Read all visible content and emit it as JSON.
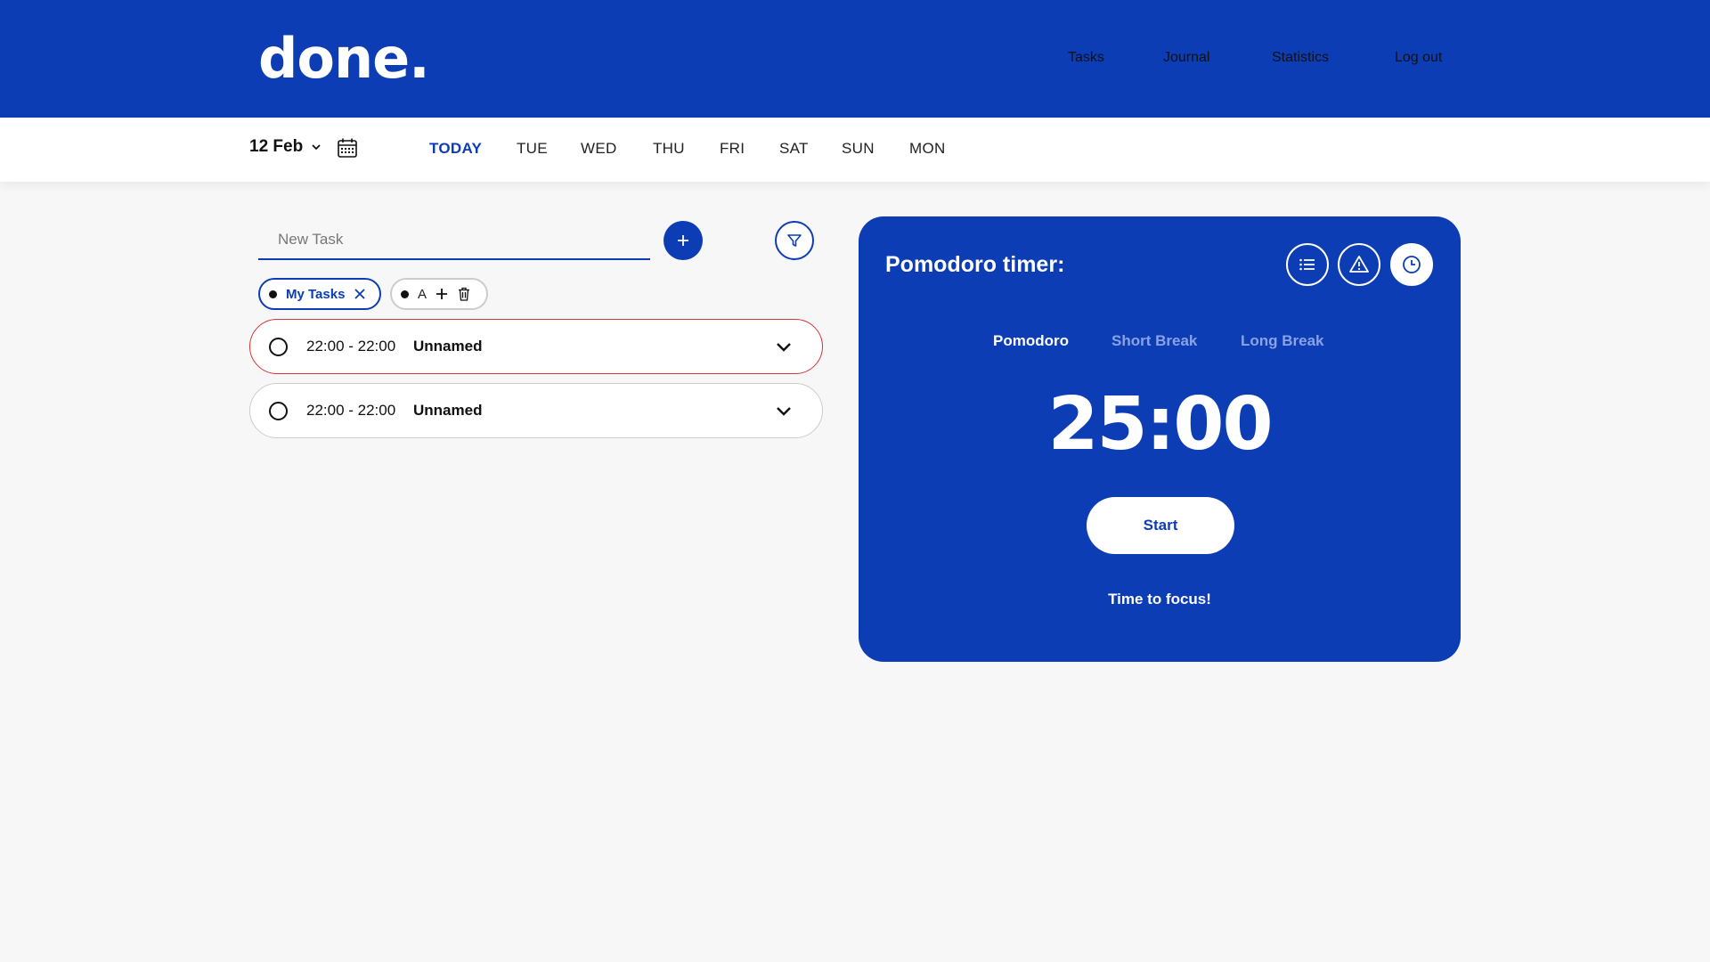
{
  "header": {
    "logo": "done.",
    "nav": [
      "Tasks",
      "Journal",
      "Statistics",
      "Log out"
    ]
  },
  "daybar": {
    "date": "12 Feb",
    "days": [
      "TODAY",
      "TUE",
      "WED",
      "THU",
      "FRI",
      "SAT",
      "SUN",
      "MON"
    ],
    "active_day": "TODAY"
  },
  "tasks_panel": {
    "new_task_placeholder": "New Task",
    "chips": [
      {
        "label": "My Tasks"
      },
      {
        "label": "A"
      }
    ],
    "tasks": [
      {
        "time": "22:00 - 22:00",
        "name": "Unnamed",
        "highlighted": true
      },
      {
        "time": "22:00 - 22:00",
        "name": "Unnamed",
        "highlighted": false
      }
    ]
  },
  "pomodoro": {
    "title": "Pomodoro timer:",
    "icons": [
      "list-icon",
      "warning-icon",
      "clock-icon"
    ],
    "active_icon": "clock-icon",
    "modes": [
      "Pomodoro",
      "Short Break",
      "Long Break"
    ],
    "active_mode": "Pomodoro",
    "time": "25:00",
    "start_label": "Start",
    "message": "Time to focus!"
  },
  "colors": {
    "brand": "#0c3db5",
    "alert": "#d43535",
    "background": "#f7f7f7"
  }
}
